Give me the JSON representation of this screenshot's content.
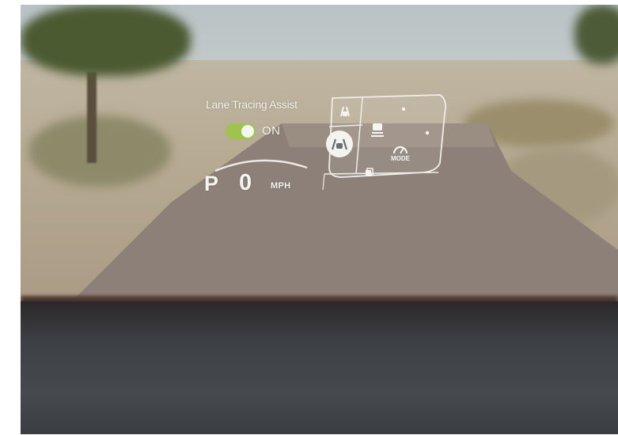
{
  "hud": {
    "title": "Lane Tracing Assist",
    "toggle_state": "ON",
    "gear": "P",
    "speed": "0",
    "speed_unit": "MPH",
    "mode_label": "MODE"
  },
  "icons": [
    "lane-assist-icon",
    "lane-tracing-selected-icon",
    "vehicle-distance-icon",
    "drive-mode-icon",
    "page-icon"
  ],
  "colors": {
    "toggle_on": "#9ec34f",
    "hud_text": "#f5f5f2"
  }
}
